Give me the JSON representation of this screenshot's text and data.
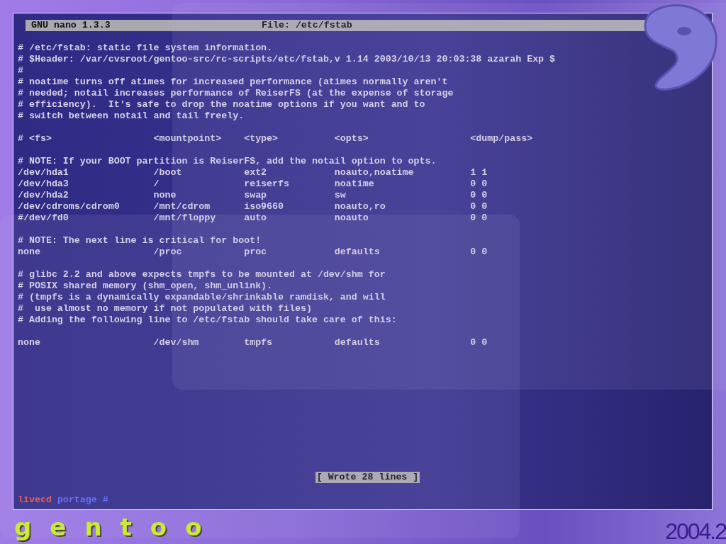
{
  "editor": {
    "title": "GNU nano 1.3.3",
    "file": "File: /etc/fstab",
    "blocks": [
      [
        "# /etc/fstab: static file system information.",
        "# $Header: /var/cvsroot/gentoo-src/rc-scripts/etc/fstab,v 1.14 2003/10/13 20:03:38 azarah Exp $",
        "#",
        "# noatime turns off atimes for increased performance (atimes normally aren't",
        "# needed; notail increases performance of ReiserFS (at the expense of storage",
        "# efficiency).  It's safe to drop the noatime options if you want and to",
        "# switch between notail and tail freely."
      ],
      [
        "# <fs>                  <mountpoint>    <type>          <opts>                  <dump/pass>"
      ],
      [
        "# NOTE: If your BOOT partition is ReiserFS, add the notail option to opts.",
        "/dev/hda1               /boot           ext2            noauto,noatime          1 1",
        "/dev/hda3               /               reiserfs        noatime                 0 0",
        "/dev/hda2               none            swap            sw                      0 0",
        "/dev/cdroms/cdrom0      /mnt/cdrom      iso9660         noauto,ro               0 0",
        "#/dev/fd0               /mnt/floppy     auto            noauto                  0 0"
      ],
      [
        "# NOTE: The next line is critical for boot!",
        "none                    /proc           proc            defaults                0 0"
      ],
      [
        "# glibc 2.2 and above expects tmpfs to be mounted at /dev/shm for",
        "# POSIX shared memory (shm_open, shm_unlink).",
        "# (tmpfs is a dynamically expandable/shrinkable ramdisk, and will",
        "#  use almost no memory if not populated with files)",
        "# Adding the following line to /etc/fstab should take care of this:"
      ],
      [
        "none                    /dev/shm        tmpfs           defaults                0 0"
      ]
    ],
    "status": "[ Wrote 28 lines ]"
  },
  "prompt": {
    "host": "livecd",
    "path": "portage #"
  },
  "branding": {
    "logo": "gentoo",
    "version": "2004.2"
  }
}
